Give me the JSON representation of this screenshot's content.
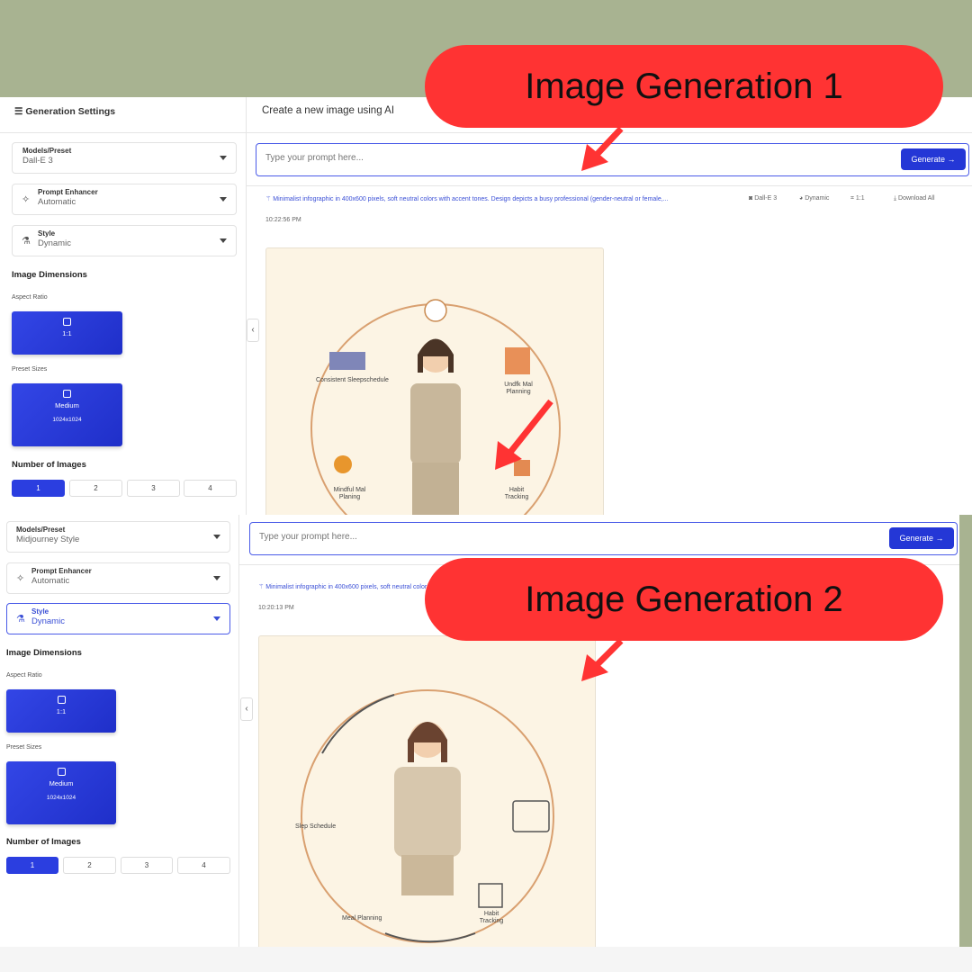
{
  "callouts": [
    "Image Generation 1",
    "Image Generation 2"
  ],
  "colors": {
    "background": "#a8b391",
    "accent": "#2437d6",
    "callout": "#ff3333"
  },
  "shot1": {
    "sidebar_title": "Generation Settings",
    "main_title": "Create a new image using AI",
    "model": {
      "label": "Models/Preset",
      "value": "Dall-E 3"
    },
    "enhancer": {
      "label": "Prompt Enhancer",
      "value": "Automatic"
    },
    "style": {
      "label": "Style",
      "value": "Dynamic"
    },
    "dimensions": "Image Dimensions",
    "aspect_label": "Aspect Ratio",
    "aspect_value": "1:1",
    "preset_label": "Preset Sizes",
    "preset_value": "Medium",
    "preset_size": "1024x1024",
    "num_label": "Number of Images",
    "nums": [
      "1",
      "2",
      "3",
      "4"
    ],
    "prompt_placeholder": "Type your prompt here...",
    "generate": "Generate →",
    "prompt_text": "Minimalist infographic in 400x600 pixels, soft neutral colors with accent tones. Design depicts a busy professional (gender-neutral or female,...",
    "meta_model": "Dall-E 3",
    "meta_style": "Dynamic",
    "meta_ratio": "1:1",
    "download": "Download All",
    "time": "10:22:56 PM",
    "captions": [
      "Consistent Sleepschedule",
      "Undfk Mal Planning",
      "Mindful Mal Planing",
      "Habit Tracking"
    ]
  },
  "shot2": {
    "model": {
      "label": "Models/Preset",
      "value": "Midjourney Style"
    },
    "enhancer": {
      "label": "Prompt Enhancer",
      "value": "Automatic"
    },
    "style": {
      "label": "Style",
      "value": "Dynamic"
    },
    "dimensions": "Image Dimensions",
    "aspect_label": "Aspect Ratio",
    "aspect_value": "1:1",
    "preset_label": "Preset Sizes",
    "preset_value": "Medium",
    "preset_size": "1024x1024",
    "num_label": "Number of Images",
    "nums": [
      "1",
      "2",
      "3",
      "4"
    ],
    "prompt_placeholder": "Type your prompt here...",
    "generate": "Generate →",
    "prompt_text": "Minimalist infographic in 400x600 pixels, soft neutral colors",
    "time": "10:20:13 PM",
    "captions": [
      "Slep Schedule",
      "Meal Planning",
      "Habit Tracking"
    ]
  }
}
